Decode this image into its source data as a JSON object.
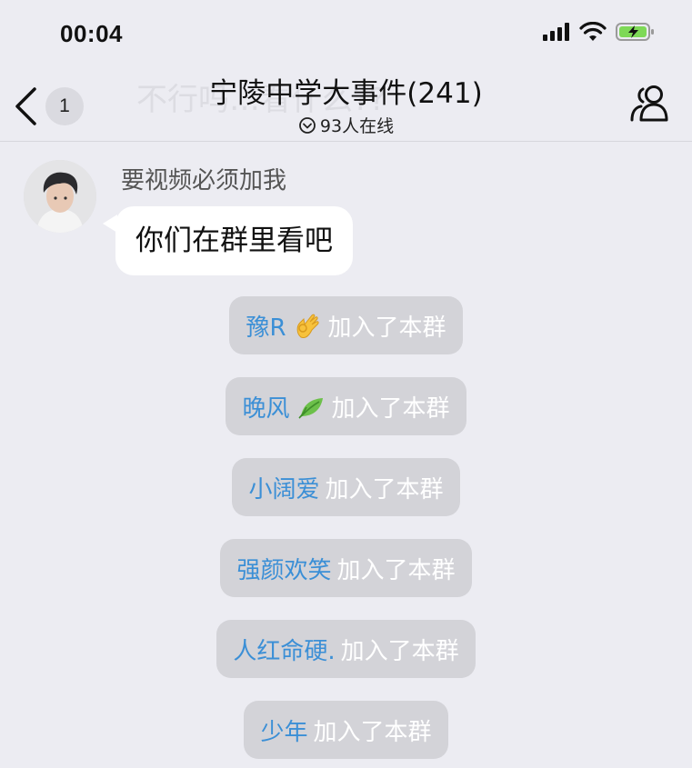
{
  "status_bar": {
    "time": "00:04"
  },
  "header": {
    "ghost_text": "不行吗…看什么??",
    "unread_count": "1",
    "title": "宁陵中学大事件(241)",
    "online": "93人在线"
  },
  "message": {
    "sender": "要视频必须加我",
    "text": "你们在群里看吧"
  },
  "notices": [
    {
      "name": "豫R",
      "emoji": "ok-hand-emoji",
      "suffix": "加入了本群"
    },
    {
      "name": "晚风",
      "emoji": "leaf-emoji",
      "suffix": "加入了本群"
    },
    {
      "name": "小阔爱",
      "suffix": "加入了本群"
    },
    {
      "name": "强颜欢笑",
      "suffix": "加入了本群"
    },
    {
      "name": "人红命硬.",
      "suffix": "加入了本群"
    },
    {
      "name": "少年",
      "suffix": "加入了本群"
    }
  ],
  "colors": {
    "background": "#ececf2",
    "username_link": "#3b8fd6",
    "notice_bg": "#d3d3d8",
    "battery_fill": "#7ed957"
  }
}
